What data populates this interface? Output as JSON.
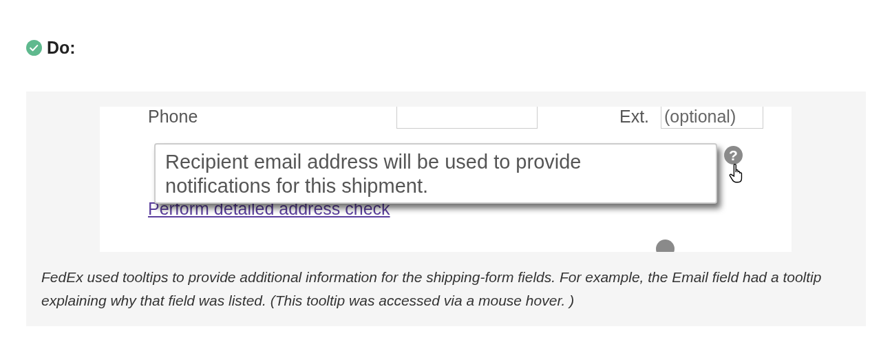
{
  "heading": {
    "text": "Do:",
    "checked": true
  },
  "screenshot": {
    "phone_label": "Phone",
    "ext_label": "Ext.",
    "ext_placeholder": "(optional)",
    "link": "Perform detailed address check",
    "help_icon": "?",
    "tooltip": "Recipient email address will be used to provide notifications for this shipment."
  },
  "caption": "FedEx used tooltips to provide additional information for the shipping-form fields. For example, the Email field had a tooltip explaining why that field was listed. (This tooltip was accessed via a mouse hover. )"
}
